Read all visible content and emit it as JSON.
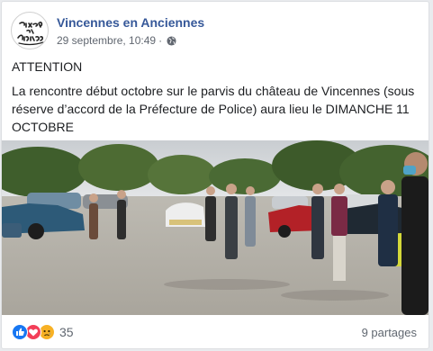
{
  "post": {
    "page_name": "Vincennes en Anciennes",
    "avatar_text": "Vincennes en Anciennes",
    "date": "29 septembre, 10:49",
    "separator": "·",
    "privacy_icon": "globe-icon",
    "attention": "ATTENTION",
    "body": "La rencontre début octobre sur le parvis du château de Vincennes (sous réserve d’accord de la Préfecture de Police) aura lieu le DIMANCHE 11 OCTOBRE",
    "photo_icon": "car-meetup-photo"
  },
  "footer": {
    "reaction_icons": [
      "like-icon",
      "love-icon",
      "sad-icon"
    ],
    "reaction_count": "35",
    "shares": "9 partages"
  },
  "colors": {
    "page_link": "#365899",
    "like": "#1877f2",
    "love": "#f33e58",
    "sad": "#f7b125",
    "meta_text": "#616770"
  }
}
